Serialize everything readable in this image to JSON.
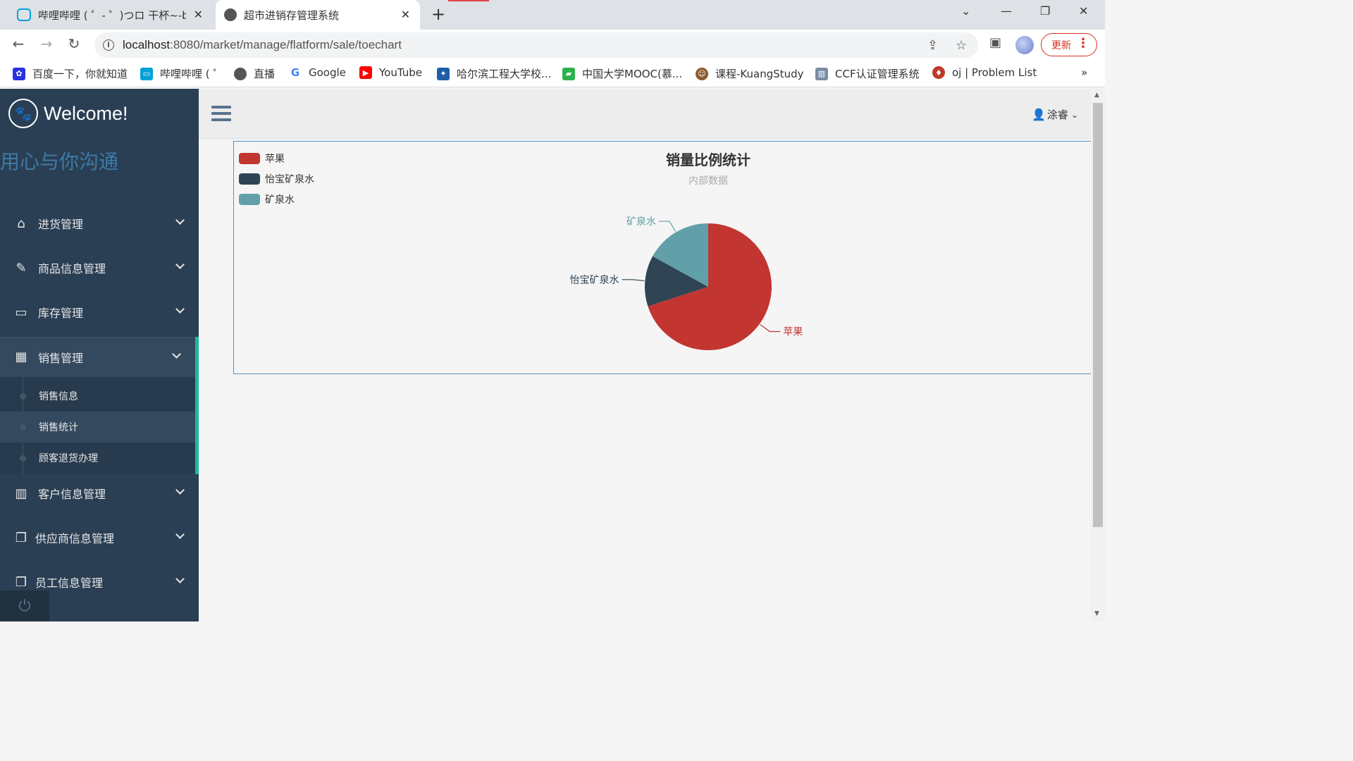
{
  "browser": {
    "tabs": [
      {
        "title": "哔哩哔哩 ( ゜- ゜)つロ 干杯~-bilibili",
        "icon": "bilibili-icon",
        "active": false
      },
      {
        "title": "超市进销存管理系统",
        "icon": "globe-icon",
        "active": true
      }
    ],
    "url_host": "localhost",
    "url_rest": ":8080/market/manage/flatform/sale/toechart",
    "update_label": "更新",
    "bookmarks": [
      {
        "label": "百度一下，你就知道",
        "icon": "baidu-icon",
        "color": "#2932e1"
      },
      {
        "label": "哔哩哔哩 ( ゜",
        "icon": "bilibili-icon",
        "color": "#00a1d6"
      },
      {
        "label": "直播",
        "icon": "globe-icon",
        "color": "#555555"
      },
      {
        "label": "Google",
        "icon": "google-icon",
        "color": "#4285f4"
      },
      {
        "label": "YouTube",
        "icon": "youtube-icon",
        "color": "#ff0000"
      },
      {
        "label": "哈尔滨工程大学校...",
        "icon": "heu-icon",
        "color": "#1f5fa8"
      },
      {
        "label": "中国大学MOOC(慕...",
        "icon": "mooc-icon",
        "color": "#2bb24c"
      },
      {
        "label": "课程-KuangStudy",
        "icon": "kuang-icon",
        "color": "#8b5a2b"
      },
      {
        "label": "CCF认证管理系统",
        "icon": "ccf-icon",
        "color": "#7a8ca5"
      },
      {
        "label": "oj | Problem List",
        "icon": "oj-icon",
        "color": "#c0392b"
      }
    ],
    "more_bookmarks": "»"
  },
  "sidebar": {
    "brand": "Welcome!",
    "slogan": "用心与你沟通",
    "menu": [
      {
        "label": "进货管理",
        "icon": "home-icon"
      },
      {
        "label": "商品信息管理",
        "icon": "edit-icon"
      },
      {
        "label": "库存管理",
        "icon": "desktop-icon"
      },
      {
        "label": "销售管理",
        "icon": "table-icon",
        "active": true
      },
      {
        "label": "客户信息管理",
        "icon": "bar-chart-icon"
      },
      {
        "label": "供应商信息管理",
        "icon": "clone-icon"
      },
      {
        "label": "员工信息管理",
        "icon": "clone-icon"
      }
    ],
    "submenu": [
      {
        "label": "销售信息"
      },
      {
        "label": "销售统计",
        "current": true
      },
      {
        "label": "顾客退货办理"
      }
    ]
  },
  "topbar": {
    "user": "涂睿"
  },
  "chart_data": {
    "type": "pie",
    "title": "销量比例统计",
    "subtitle": "内部数据",
    "legend_position": "top-left",
    "series": [
      {
        "name": "苹果",
        "value": 70,
        "color": "#c23531"
      },
      {
        "name": "怡宝矿泉水",
        "value": 13,
        "color": "#2f4554"
      },
      {
        "name": "矿泉水",
        "value": 17,
        "color": "#61a0a8"
      }
    ]
  }
}
